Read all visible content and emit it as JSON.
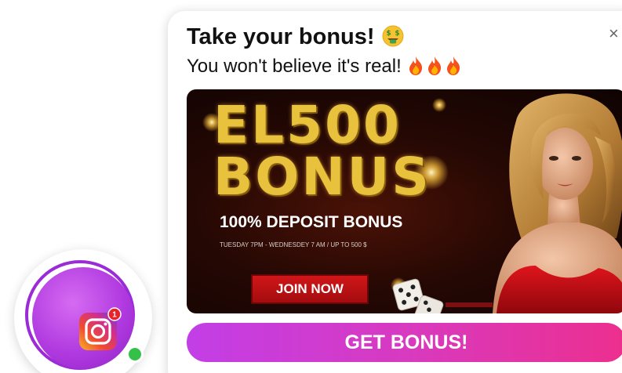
{
  "popup": {
    "title": "Take your bonus!",
    "title_emoji_icon": "money-mouth-face-icon",
    "subtitle": "You won't believe it's real!",
    "subtitle_emoji_icons": [
      "fire-icon",
      "fire-icon",
      "fire-icon"
    ],
    "close_label": "×",
    "cta_label": "GET BONUS!",
    "cta_colors": [
      "#c23ee6",
      "#ec2f8e"
    ]
  },
  "banner": {
    "headline": "EL500",
    "headline_bonus": "BONUS",
    "deposit_text": "100% DEPOSIT BONUS",
    "schedule_text": "TUESDAY 7PM - WEDNESDEY 7 AM / UP TO 500 $",
    "join_label": "JOIN NOW",
    "gold_color": "#e9c23d",
    "join_color": "#c8141a"
  },
  "avatar": {
    "icon": "instagram-icon",
    "notification_count": "1",
    "status": "online",
    "status_color": "#35c04a",
    "ring_color": "#9b2bd6"
  }
}
